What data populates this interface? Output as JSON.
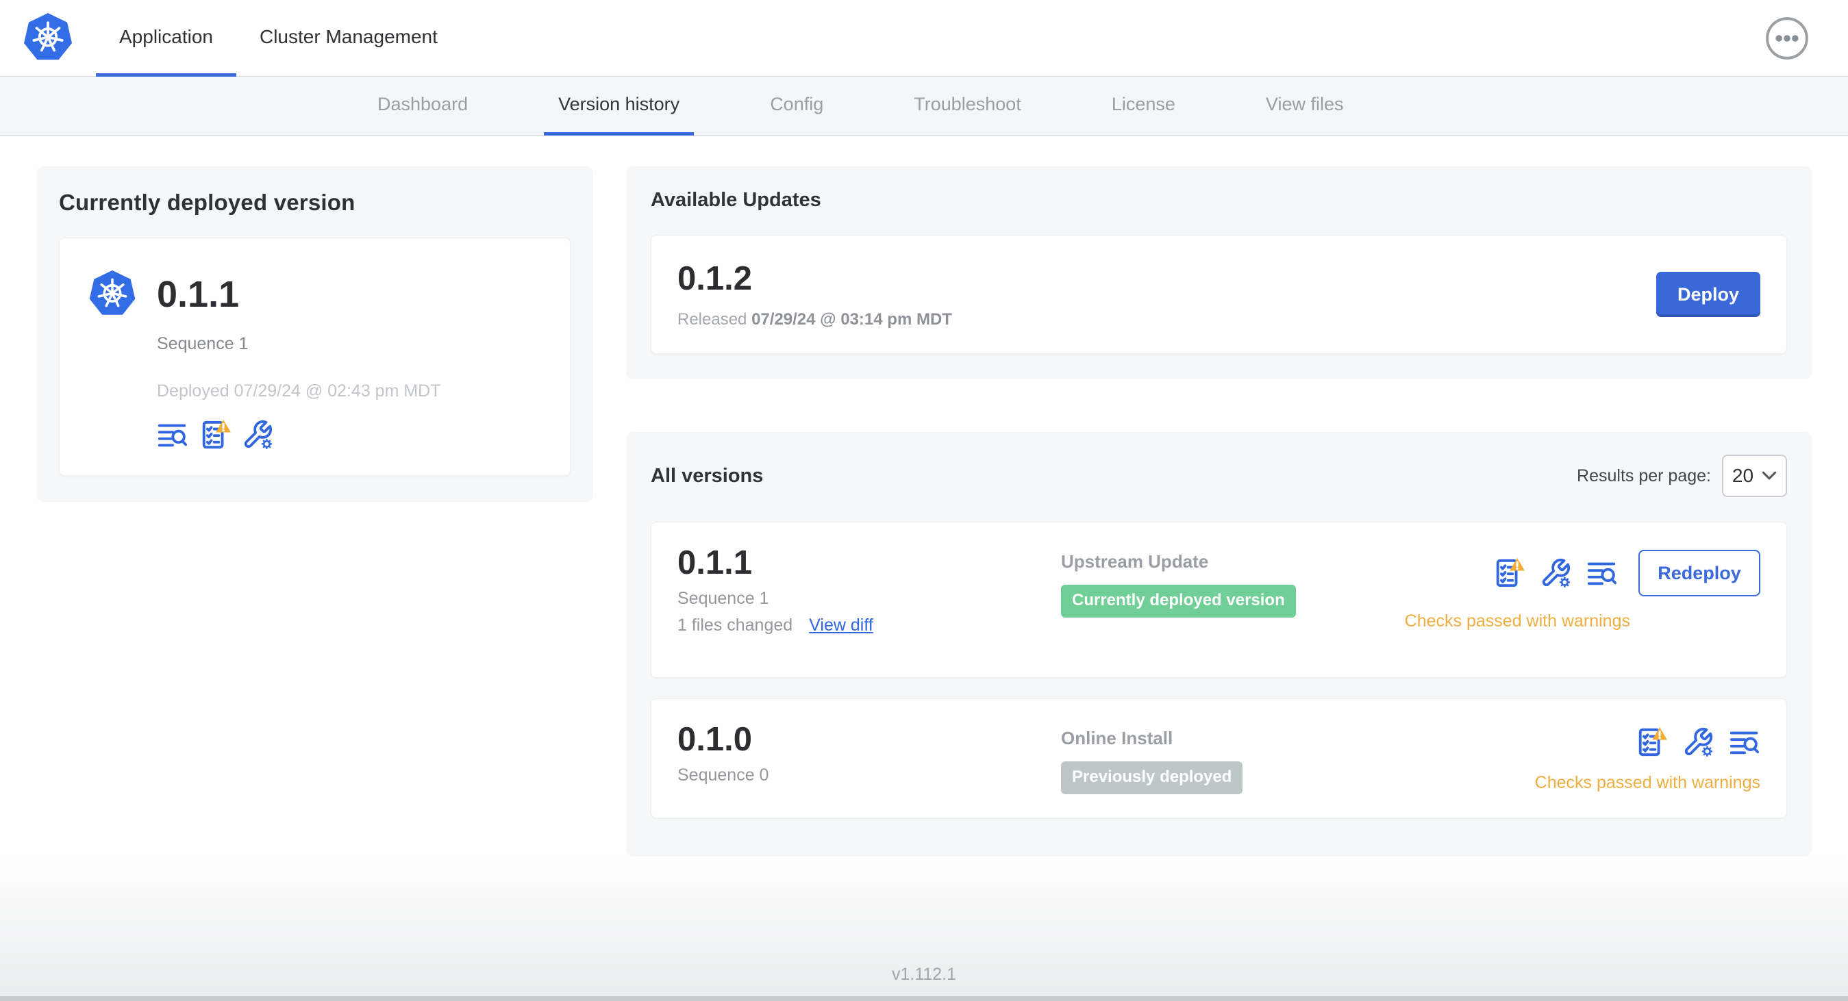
{
  "header": {
    "tabs": [
      {
        "label": "Application",
        "active": true
      },
      {
        "label": "Cluster Management",
        "active": false
      }
    ]
  },
  "subnav": {
    "tabs": [
      {
        "label": "Dashboard",
        "active": false
      },
      {
        "label": "Version history",
        "active": true
      },
      {
        "label": "Config",
        "active": false
      },
      {
        "label": "Troubleshoot",
        "active": false
      },
      {
        "label": "License",
        "active": false
      },
      {
        "label": "View files",
        "active": false
      }
    ]
  },
  "current_version": {
    "title": "Currently deployed version",
    "version": "0.1.1",
    "sequence": "Sequence 1",
    "deployed": "Deployed 07/29/24 @ 02:43 pm MDT"
  },
  "available_updates": {
    "title": "Available Updates",
    "version": "0.1.2",
    "released_label": "Released",
    "released_value": "07/29/24 @ 03:14 pm MDT",
    "deploy_button": "Deploy"
  },
  "all_versions": {
    "title": "All versions",
    "results_per_page_label": "Results per page:",
    "results_per_page_value": "20",
    "rows": [
      {
        "version": "0.1.1",
        "sequence": "Sequence 1",
        "files_changed": "1 files changed",
        "view_diff_link": "View diff",
        "source": "Upstream Update",
        "badge": "Currently deployed version",
        "action_button": "Redeploy",
        "status": "Checks passed with warnings"
      },
      {
        "version": "0.1.0",
        "sequence": "Sequence 0",
        "source": "Online Install",
        "badge": "Previously deployed",
        "status": "Checks passed with warnings"
      }
    ]
  },
  "footer": {
    "app_version": "v1.112.1"
  },
  "colors": {
    "accent_blue": "#3b6bda",
    "link_blue": "#3066e0",
    "kubernetes_blue": "#326de5",
    "badge_green": "#6fcf97",
    "badge_gray": "#bdc7c9",
    "warning_amber": "#efae41",
    "warning_triangle": "#f0ac33",
    "panel_bg": "#f5f7f8",
    "subnav_bg": "#f4f6f8"
  }
}
